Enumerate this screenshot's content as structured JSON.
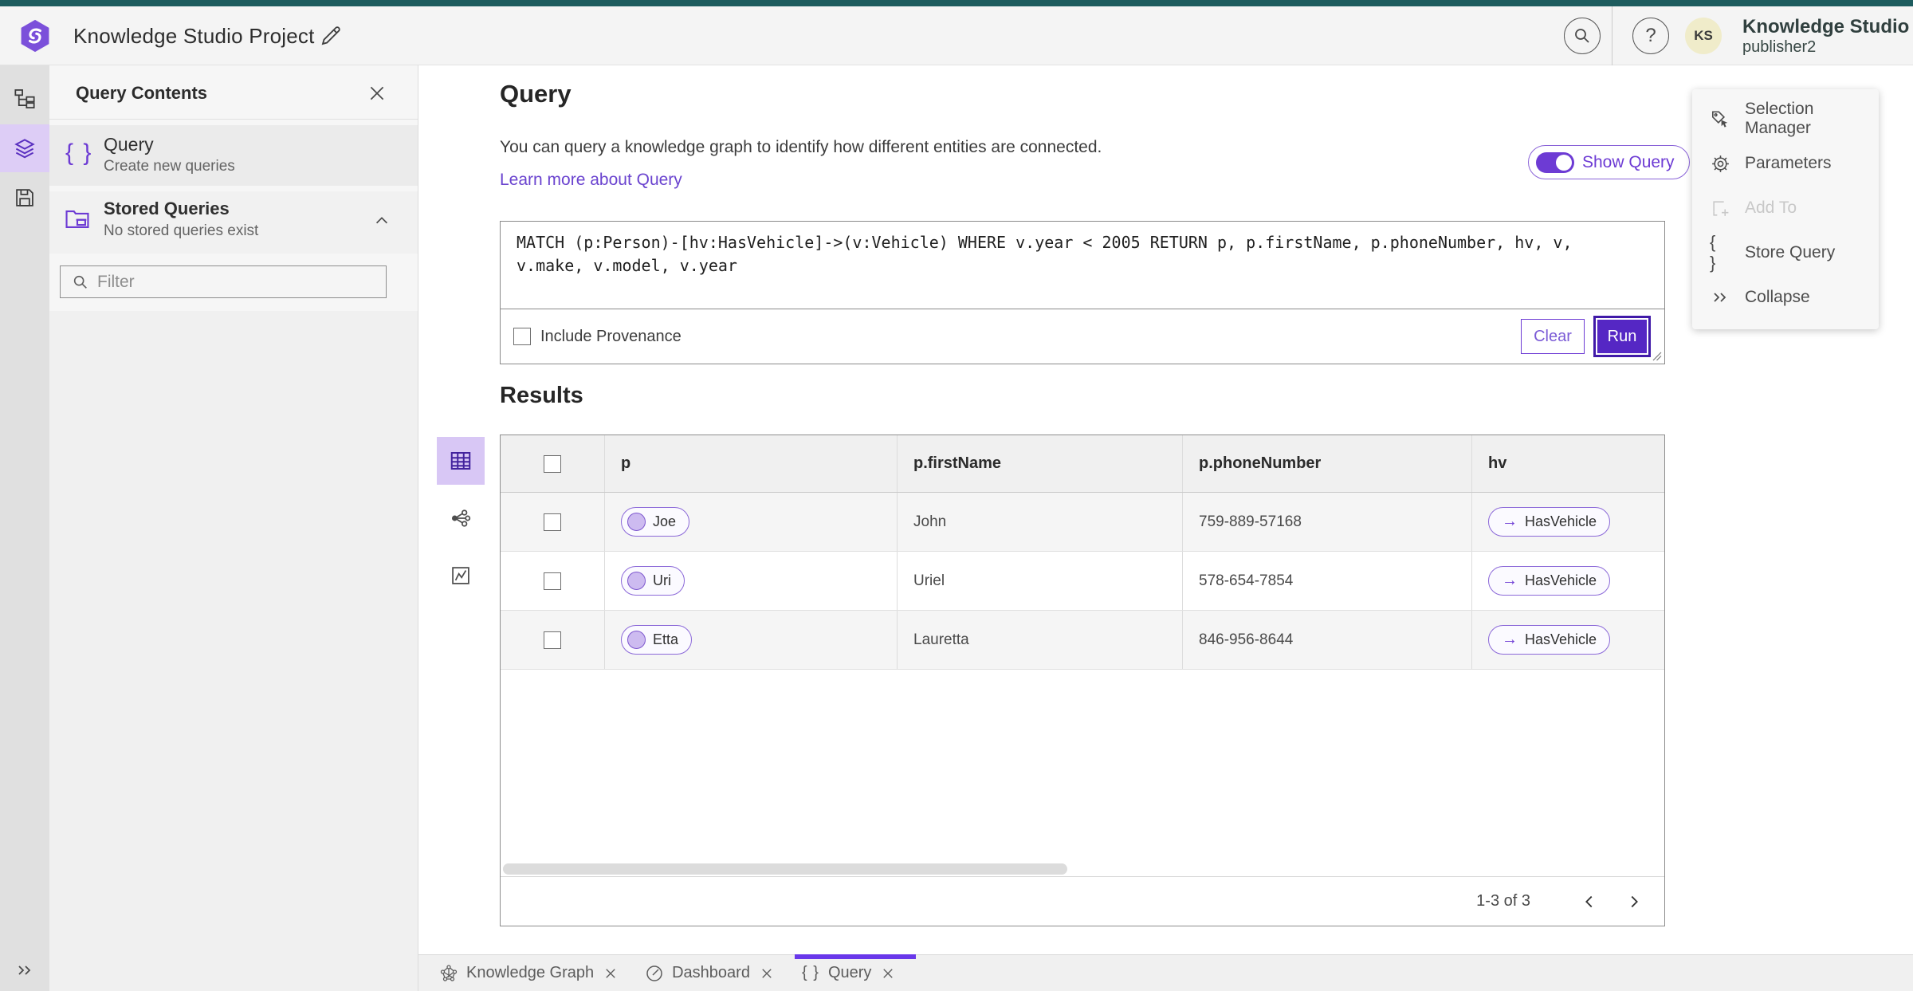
{
  "colors": {
    "top_strip_teal": "#1d5c5e",
    "accent_purple": "#6d3bd4",
    "run_button_purple": "#5527c4",
    "rail_selected_bg": "#ddcdf6",
    "avatar_bg": "#f0ecca"
  },
  "header": {
    "title": "Knowledge Studio Project",
    "product_name": "Knowledge Studio",
    "user_name": "publisher2",
    "avatar_initials": "KS",
    "help_glyph": "?"
  },
  "left_panel": {
    "title": "Query Contents",
    "query_item": {
      "icon": "braces-icon",
      "glyph": "{ }",
      "title": "Query",
      "subtitle": "Create new queries"
    },
    "stored": {
      "title": "Stored Queries",
      "subtitle": "No stored queries exist"
    },
    "filter_placeholder": "Filter"
  },
  "query_section": {
    "title": "Query",
    "description": "You can query a knowledge graph to identify how different entities are connected.",
    "learn_more": "Learn more about Query",
    "show_query_label": "Show Query",
    "query_text": "MATCH (p:Person)-[hv:HasVehicle]->(v:Vehicle) WHERE v.year < 2005 RETURN p, p.firstName, p.phoneNumber, hv, v, v.make, v.model, v.year",
    "include_provenance_label": "Include Provenance",
    "clear_label": "Clear",
    "run_label": "Run"
  },
  "results": {
    "title": "Results",
    "columns": [
      "p",
      "p.firstName",
      "p.phoneNumber",
      "hv"
    ],
    "rows": [
      {
        "p": "Joe",
        "firstName": "John",
        "phone": "759-889-57168",
        "hv": "HasVehicle",
        "arrow": "→"
      },
      {
        "p": "Uri",
        "firstName": "Uriel",
        "phone": "578-654-7854",
        "hv": "HasVehicle",
        "arrow": "→"
      },
      {
        "p": "Etta",
        "firstName": "Lauretta",
        "phone": "846-956-8644",
        "hv": "HasVehicle",
        "arrow": "→"
      }
    ],
    "pagination": "1-3 of 3"
  },
  "right_panel": {
    "items": [
      {
        "label": "Selection Manager"
      },
      {
        "label": "Parameters"
      },
      {
        "label": "Add To"
      },
      {
        "label": "Store Query",
        "glyph": "{ }"
      },
      {
        "label": "Collapse"
      }
    ]
  },
  "tabs": [
    {
      "label": "Knowledge Graph"
    },
    {
      "label": "Dashboard"
    },
    {
      "label": "Query",
      "glyph": "{ }"
    }
  ]
}
